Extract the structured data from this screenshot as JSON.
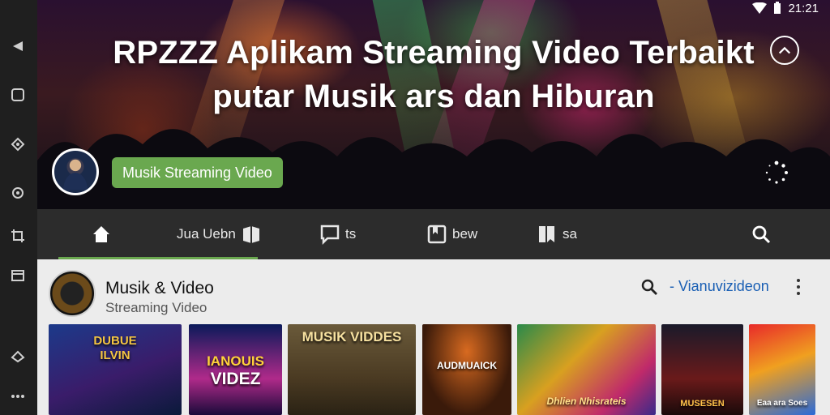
{
  "status": {
    "time": "21:21"
  },
  "hero": {
    "title_line1": "RPZZZ Aplikam Streaming Video Terbaikt",
    "title_line2": "putar Musik ars  dan Hiburan",
    "tag": "Musik Streaming Video"
  },
  "tabs": [
    {
      "label": "Jua Uebn",
      "icon": "home-icon"
    },
    {
      "label": "",
      "icon": "library-icon"
    },
    {
      "label": "ts",
      "icon": "chat-icon"
    },
    {
      "label": "bew",
      "icon": "bookmark-icon"
    },
    {
      "label": "sa",
      "icon": "playlist-icon"
    }
  ],
  "channel": {
    "name": "Musik & Video",
    "subtitle": "Streaming Video",
    "link": "- Vianuvizideon"
  },
  "thumbnails": [
    {
      "line1": "DUBUE",
      "line2": "ILVIN"
    },
    {
      "line1": "IANOUIS",
      "line2": "VIDEZ"
    },
    {
      "line1": "MUSIK VIDDES",
      "line2": ""
    },
    {
      "line1": "AUDMUAICK",
      "line2": ""
    },
    {
      "line1": "Dhlien Nhisrateis",
      "line2": ""
    },
    {
      "line1": "MUSESEN",
      "line2": ""
    },
    {
      "line1": "Eaa ara Soes",
      "line2": ""
    }
  ],
  "colors": {
    "accent": "#6aa84f",
    "link": "#1a5fb4"
  }
}
